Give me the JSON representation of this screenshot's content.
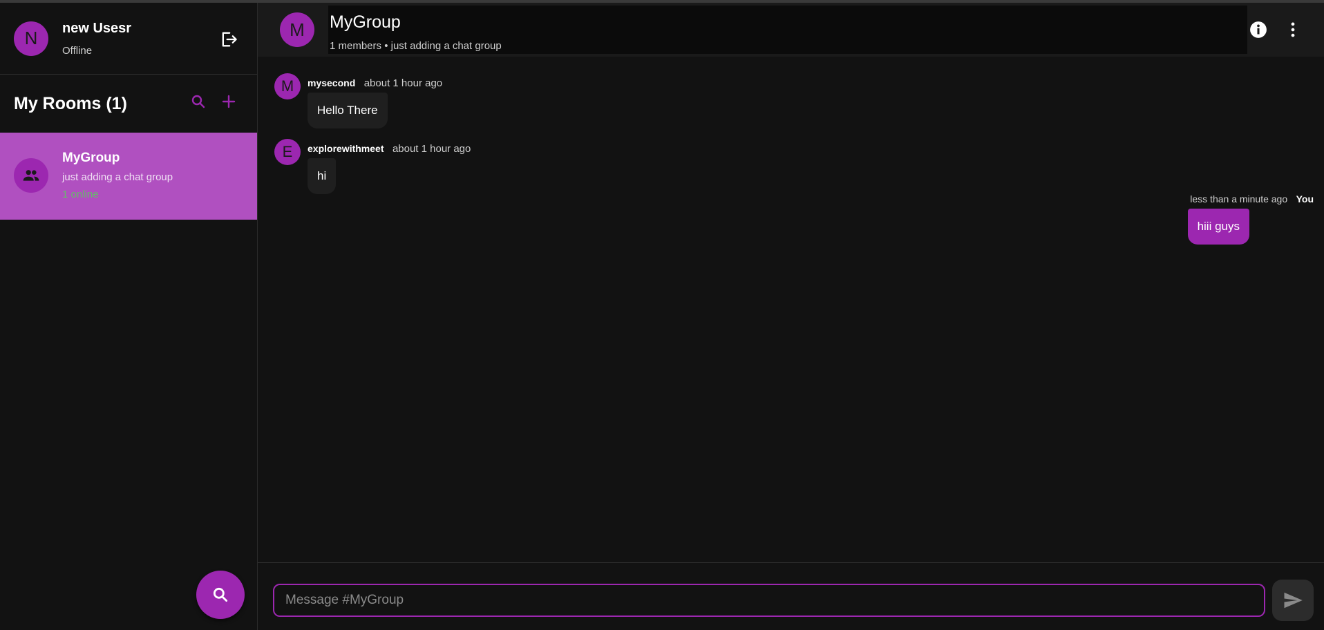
{
  "user": {
    "avatar_letter": "N",
    "name": "new Usesr",
    "status": "Offline",
    "logout_icon": "logout-icon"
  },
  "rooms": {
    "title": "My Rooms (1)",
    "search_icon": "search-icon",
    "add_icon": "add-icon",
    "items": [
      {
        "name": "MyGroup",
        "description": "just adding a chat group",
        "online": "1 online",
        "icon": "group-icon"
      }
    ]
  },
  "chat": {
    "avatar_letter": "M",
    "title": "MyGroup",
    "subtitle": "1 members • just adding a chat group",
    "info_icon": "info-icon",
    "more_icon": "more-vert-icon"
  },
  "messages": [
    {
      "avatar_letter": "M",
      "author": "mysecond",
      "time": "about 1 hour ago",
      "text": "Hello There"
    },
    {
      "avatar_letter": "E",
      "author": "explorewithmeet",
      "time": "about 1 hour ago",
      "text": "hi"
    }
  ],
  "self_message": {
    "time": "less than a minute ago",
    "author": "You",
    "text": "hiii guys"
  },
  "composer": {
    "placeholder": "Message #MyGroup",
    "send_icon": "send-icon"
  },
  "fab": {
    "icon": "search-icon"
  },
  "colors": {
    "accent": "#9c27b0",
    "selected_room": "#b050c0",
    "online": "#66bb6a",
    "background": "#121212"
  }
}
